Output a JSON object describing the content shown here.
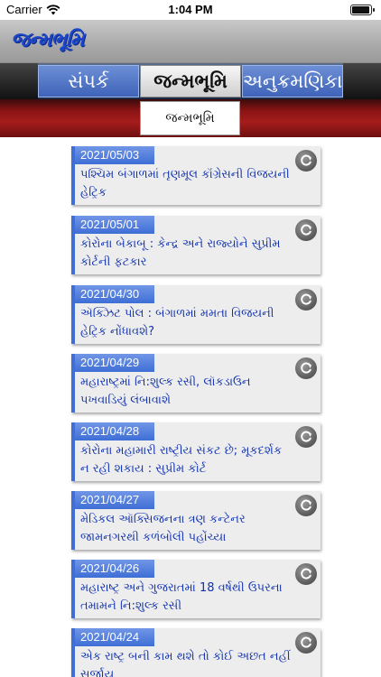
{
  "status_bar": {
    "carrier": "Carrier",
    "time": "1:04 PM",
    "battery_level": 1.0
  },
  "header": {
    "logo_text": "જન્મભૂમિ"
  },
  "tabs": [
    {
      "label": "સંપર્ક",
      "active": false
    },
    {
      "label": "જન્મભૂમિ",
      "active": true
    },
    {
      "label": "અનુક્રમણિકા",
      "active": false
    }
  ],
  "sub_header": {
    "label": "જન્મભૂમિ"
  },
  "articles": [
    {
      "date": "2021/05/03",
      "headline": "પશ્ચિમ બંગાળમાં તૃણમૂલ કૉંગ્રેસની વિજયની હેટ્રિક"
    },
    {
      "date": "2021/05/01",
      "headline": "કોરોના બેકાબૂ : કેન્દ્ર અને રાજ્યોને સુપ્રીમ કોર્ટની ફટકાર"
    },
    {
      "date": "2021/04/30",
      "headline": "ઍક્ઝિટ પોલ : બંગાળમાં મમતા વિજયની હેટ્રિક નોંધાવશે?"
    },
    {
      "date": "2021/04/29",
      "headline": "મહારાષ્ટ્રમાં નિ:શુલ્ક રસી, લૉકડાઉન પખવાડિયું લંબાવાશે"
    },
    {
      "date": "2021/04/28",
      "headline": "કોરોના મહામારી રાષ્ટ્રીય સંકટ છે; મૂકદર્શક ન રહી શકાય : સુપ્રીમ કોર્ટ"
    },
    {
      "date": "2021/04/27",
      "headline": "મેડિકલ ઑક્સિજનના ત્રણ કન્ટેનર જામનગરથી કળંબોલી પહોંચ્યા"
    },
    {
      "date": "2021/04/26",
      "headline": "મહારાષ્ટ્ર અને ગુજરાતમાં 18 વર્ષથી ઉપરના તમામને નિ:શુલ્ક રસી"
    },
    {
      "date": "2021/04/24",
      "headline": "એક રાષ્ટ્ર બની કામ થશે તો કોઈ અછત નહીં સર્જાય"
    }
  ]
}
